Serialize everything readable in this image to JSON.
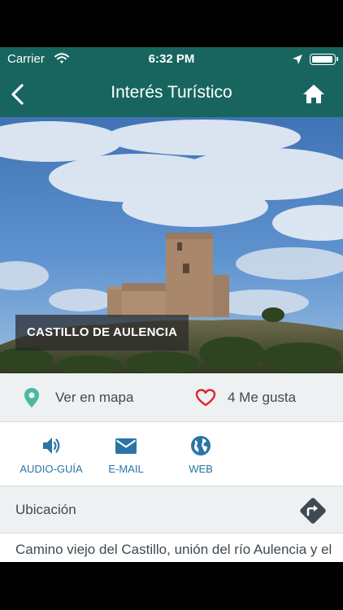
{
  "status": {
    "carrier": "Carrier",
    "time": "6:32 PM"
  },
  "nav": {
    "title": "Interés Turístico",
    "back_icon": "chevron-left-icon",
    "home_icon": "home-icon"
  },
  "hero": {
    "caption": "CASTILLO DE AULENCIA"
  },
  "info_row": {
    "map_label": "Ver en mapa",
    "likes_label": "4 Me gusta",
    "map_icon_color": "#4cb8a4",
    "like_icon_color": "#e0202c"
  },
  "actions": [
    {
      "label": "AUDIO-GUÍA",
      "icon": "speaker-icon"
    },
    {
      "label": "E-MAIL",
      "icon": "envelope-icon"
    },
    {
      "label": "WEB",
      "icon": "globe-icon"
    }
  ],
  "location": {
    "heading": "Ubicación",
    "address": "Camino viejo del Castillo, unión del río Aulencia y el río Guadarrama"
  },
  "colors": {
    "brand": "#17655e",
    "accent": "#2b74a6",
    "text": "#3d4a52"
  }
}
